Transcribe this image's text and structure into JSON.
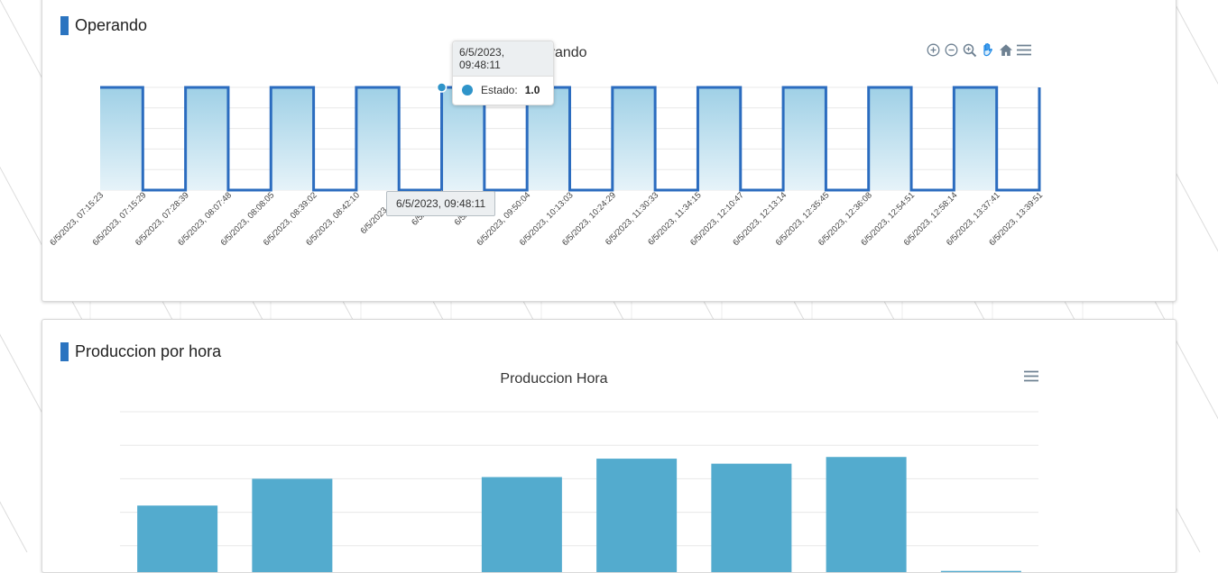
{
  "operando": {
    "card_title": "Operando",
    "chart_title": "Operando",
    "tooltip": {
      "header": "6/5/2023, 09:48:11",
      "series_label": "Estado:",
      "value": "1.0"
    },
    "x_tooltip": "6/5/2023, 09:48:11",
    "toolbar": [
      {
        "name": "zoom-in-icon"
      },
      {
        "name": "zoom-out-icon"
      },
      {
        "name": "selection-zoom-icon"
      },
      {
        "name": "pan-hand-icon"
      },
      {
        "name": "reset-home-icon"
      },
      {
        "name": "menu-icon"
      }
    ],
    "colors": {
      "line": "#2b6cbf",
      "fill_top": "#9fd0e6",
      "fill_bottom": "#e6f3f9",
      "marker": "#2f94c9"
    }
  },
  "produccion": {
    "card_title": "Produccion por hora",
    "chart_title": "Produccion Hora",
    "colors": {
      "bar": "#53abce"
    }
  },
  "chart_data": [
    {
      "type": "area",
      "title": "Operando",
      "step": true,
      "series": [
        {
          "name": "Estado",
          "values": [
            1,
            0,
            1,
            0,
            1,
            0,
            1,
            0,
            1,
            0,
            1,
            0,
            1,
            0,
            1,
            0,
            1,
            0,
            1,
            0,
            1,
            0,
            1
          ]
        }
      ],
      "x": [
        "6/5/2023, 07:15:23",
        "6/5/2023, 07:15:29",
        "6/5/2023, 07:28:39",
        "6/5/2023, 08:07:48",
        "6/5/2023, 08:08:05",
        "6/5/2023, 08:39:02",
        "6/5/2023, 08:42:10",
        "6/5/2023, 08:5",
        "6/5/2023, 0",
        "6/5/2023, 0",
        "6/5/2023, 09:50:04",
        "6/5/2023, 10:13:03",
        "6/5/2023, 10:24:29",
        "6/5/2023, 11:30:33",
        "6/5/2023, 11:34:15",
        "6/5/2023, 12:10:47",
        "6/5/2023, 12:13:14",
        "6/5/2023, 12:35:45",
        "6/5/2023, 12:36:08",
        "6/5/2023, 12:54:51",
        "6/5/2023, 12:58:14",
        "6/5/2023, 13:37:41",
        "6/5/2023, 13:39:51"
      ],
      "ylim": [
        0,
        1
      ],
      "grid": true
    },
    {
      "type": "bar",
      "title": "Produccion Hora",
      "values": [
        4.4,
        6.0,
        null,
        6.1,
        7.2,
        6.9,
        7.3,
        0.5
      ],
      "ylim": [
        0,
        10
      ],
      "grid": true
    }
  ]
}
